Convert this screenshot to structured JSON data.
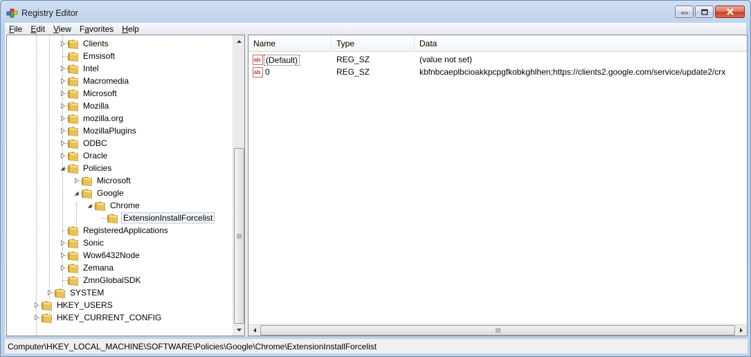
{
  "window": {
    "title": "Registry Editor",
    "icon": "registry-editor-icon",
    "buttons": [
      "minimize-icon",
      "maximize-icon",
      "close-icon"
    ]
  },
  "menu": [
    {
      "accel": "F",
      "rest": "ile"
    },
    {
      "accel": "E",
      "rest": "dit"
    },
    {
      "accel": "V",
      "rest": "iew"
    },
    {
      "accel": "",
      "pre": "F",
      "mid": "a",
      "rest": "vorites"
    },
    {
      "accel": "H",
      "rest": "elp"
    }
  ],
  "tree": {
    "items": [
      {
        "label": "Clients",
        "level": 2,
        "expander": "collapsed"
      },
      {
        "label": "Emsisoft",
        "level": 2,
        "expander": "none"
      },
      {
        "label": "Intel",
        "level": 2,
        "expander": "collapsed"
      },
      {
        "label": "Macromedia",
        "level": 2,
        "expander": "collapsed"
      },
      {
        "label": "Microsoft",
        "level": 2,
        "expander": "collapsed"
      },
      {
        "label": "Mozilla",
        "level": 2,
        "expander": "collapsed"
      },
      {
        "label": "mozilla.org",
        "level": 2,
        "expander": "collapsed"
      },
      {
        "label": "MozillaPlugins",
        "level": 2,
        "expander": "collapsed"
      },
      {
        "label": "ODBC",
        "level": 2,
        "expander": "collapsed"
      },
      {
        "label": "Oracle",
        "level": 2,
        "expander": "collapsed"
      },
      {
        "label": "Policies",
        "level": 2,
        "expander": "expanded"
      },
      {
        "label": "Microsoft",
        "level": 3,
        "expander": "collapsed"
      },
      {
        "label": "Google",
        "level": 3,
        "expander": "expanded"
      },
      {
        "label": "Chrome",
        "level": 4,
        "expander": "expanded"
      },
      {
        "label": "ExtensionInstallForcelist",
        "level": 5,
        "expander": "none",
        "selected": true
      },
      {
        "label": "RegisteredApplications",
        "level": 2,
        "expander": "none"
      },
      {
        "label": "Sonic",
        "level": 2,
        "expander": "collapsed"
      },
      {
        "label": "Wow6432Node",
        "level": 2,
        "expander": "collapsed"
      },
      {
        "label": "Zemana",
        "level": 2,
        "expander": "collapsed"
      },
      {
        "label": "ZmnGlobalSDK",
        "level": 2,
        "expander": "none"
      },
      {
        "label": "SYSTEM",
        "level": 1,
        "expander": "collapsed"
      },
      {
        "label": "HKEY_USERS",
        "level": 0,
        "expander": "collapsed"
      },
      {
        "label": "HKEY_CURRENT_CONFIG",
        "level": 0,
        "expander": "collapsed"
      }
    ]
  },
  "list": {
    "columns": [
      "Name",
      "Type",
      "Data"
    ],
    "rows": [
      {
        "name": "(Default)",
        "type": "REG_SZ",
        "data": "(value not set)",
        "icon": "string-value-icon"
      },
      {
        "name": "0",
        "type": "REG_SZ",
        "data": "kbfnbcaeplbcioakkpcpgfkobkghlhen;https://clients2.google.com/service/update2/crx",
        "icon": "string-value-icon"
      }
    ]
  },
  "status": {
    "path": "Computer\\HKEY_LOCAL_MACHINE\\SOFTWARE\\Policies\\Google\\Chrome\\ExtensionInstallForcelist"
  },
  "colors": {
    "folder": "#e8c35a",
    "titlebar": "#c9daf0",
    "close": "#c4422a"
  }
}
